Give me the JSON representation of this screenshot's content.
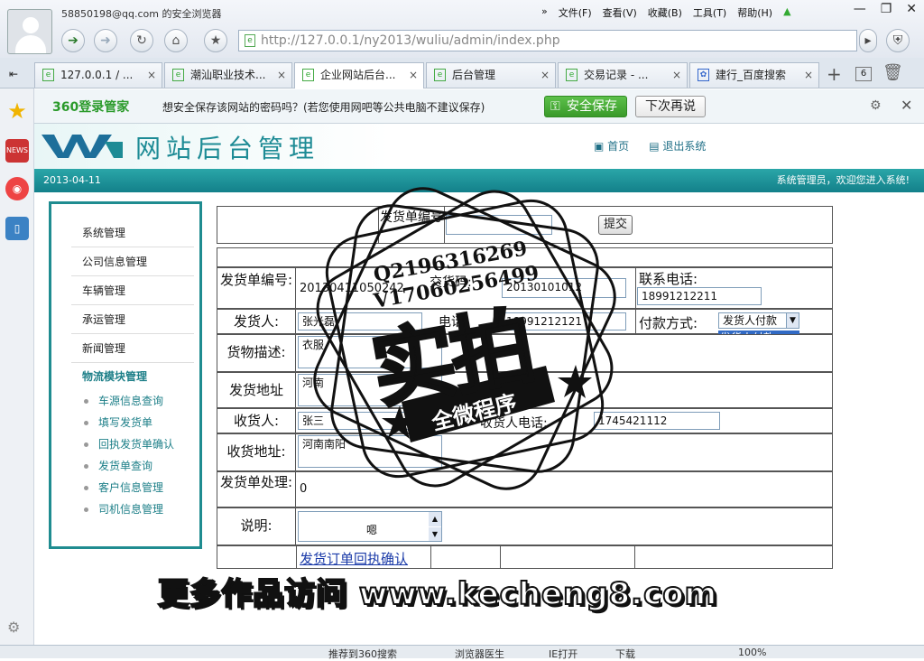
{
  "browser": {
    "window_title": "588501​98@qq.com 的安全浏览器",
    "menus": [
      "文件(F)",
      "查看(V)",
      "收藏(B)",
      "工具(T)",
      "帮助(H)"
    ],
    "address": "http://127.0.0.1/ny2013/wuliu/admin/index.php",
    "tabs": [
      {
        "label": "127.0.0.1 / ..."
      },
      {
        "label": "潮汕职业技术..."
      },
      {
        "label": "企业网站后台..."
      },
      {
        "label": "后台管理"
      },
      {
        "label": "交易记录 - ..."
      },
      {
        "label": "建行_百度搜索"
      }
    ],
    "tab_count": "6",
    "notification": {
      "brand": "360登录管家",
      "message": "想安全保存该网站的密码吗？(若您使用网吧等公共电脑不建议保存)",
      "save_button": "安全保存",
      "later_button": "下次再说"
    },
    "status": [
      "推荐到360搜索",
      "浏览器医生",
      "IE打开",
      "下载",
      "100%"
    ]
  },
  "site": {
    "title": "网站后台管理",
    "home_link": "首页",
    "logout_link": "退出系统",
    "date": "2013-04-11",
    "welcome": "系统管理员，欢迎您进入系统!"
  },
  "nav": {
    "items": [
      "系统管理",
      "公司信息管理",
      "车辆管理",
      "承运管理",
      "新闻管理"
    ],
    "module_title": "物流模块管理",
    "sub_items": [
      "车源信息查询",
      "填写发货单",
      "回执发货单确认",
      "发货单查询",
      "客户信息管理",
      "司机信息管理"
    ]
  },
  "form": {
    "search_label": "发货单编号",
    "submit_button": "提交",
    "order_no_label": "发货单编号:",
    "order_no_value": "20130411050242",
    "code_label": "交货码:",
    "code_value": "20130101012",
    "phone_label": "联系电话:",
    "phone_value": "18991212211",
    "sender_label": "发货人:",
    "sender_value": "张光磊",
    "sender_phone_label": "电话:",
    "sender_phone_value": "18991212121",
    "payment_label": "付款方式:",
    "payment_value": "发货人付款",
    "payment_options": [
      "发货人付款"
    ],
    "goods_label": "货物描述:",
    "goods_value": "衣服",
    "from_label": "发货地址",
    "from_value": "河南",
    "receiver_label": "收货人:",
    "receiver_value": "张三",
    "receiver_phone_label": "收货人电话:",
    "receiver_phone_value": "1745421112",
    "to_label": "收货地址:",
    "to_value": "河南南阳",
    "process_label": "发货单处理:",
    "process_value": "0",
    "note_label": "说明:",
    "note_value": "嗯",
    "confirm_link": "发货订单回执确认"
  },
  "overlay": {
    "stamp_line1": "Q2196316269",
    "stamp_line2": "V17060256499",
    "stamp_big": "实拍",
    "stamp_ribbon": "全微程序",
    "footer_text": "更多作品访问 www.kecheng8.com"
  }
}
